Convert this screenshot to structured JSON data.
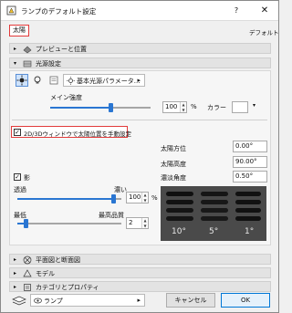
{
  "window": {
    "title": "ランプのデフォルト設定",
    "help": "?",
    "close": "✕"
  },
  "header": {
    "tab_label": "太陽",
    "default_label": "デフォルト"
  },
  "sections": {
    "preview": {
      "label": "プレビューと位置",
      "collapsed": true
    },
    "light": {
      "label": "光源設定",
      "collapsed": false
    },
    "plan": {
      "label": "平面図と断面図",
      "collapsed": true
    },
    "model": {
      "label": "モデル",
      "collapsed": true
    },
    "category": {
      "label": "カテゴリとプロパティ",
      "collapsed": true
    }
  },
  "light": {
    "param_dropdown": "基本光源パラメータ...",
    "main_intensity_label": "メイン強度",
    "main_intensity_value": "100",
    "percent": "%",
    "color_label": "カラー",
    "main_intensity_level": 0.6,
    "sun_checkbox_label": "2D/3Dウィンドウで太陽位置を手動設定",
    "sun_checkbox_checked": true,
    "sun_azimuth_label": "太陽方位",
    "sun_azimuth_value": "0.00°",
    "sun_altitude_label": "太陽高度",
    "sun_altitude_value": "90.00°",
    "shadow_checkbox_label": "影",
    "shadow_checked": true,
    "transparency_label": "透過",
    "dense_label": "濃い",
    "transparency_value": "100",
    "transparency_level": 0.92,
    "shadow_percent": "%",
    "fuzziness_label": "濃淡角度",
    "fuzziness_value": "0.50°",
    "low_label": "最低",
    "high_label": "最高品質",
    "quality_value": "2",
    "quality_level": 0.08,
    "shadow_scale": [
      "10°",
      "5°",
      "1°"
    ]
  },
  "footer": {
    "layer_dropdown": "ランプ",
    "cancel": "キャンセル",
    "ok": "OK"
  },
  "colors": {
    "accent": "#2a76d2",
    "highlight_border": "#e23a3a"
  }
}
